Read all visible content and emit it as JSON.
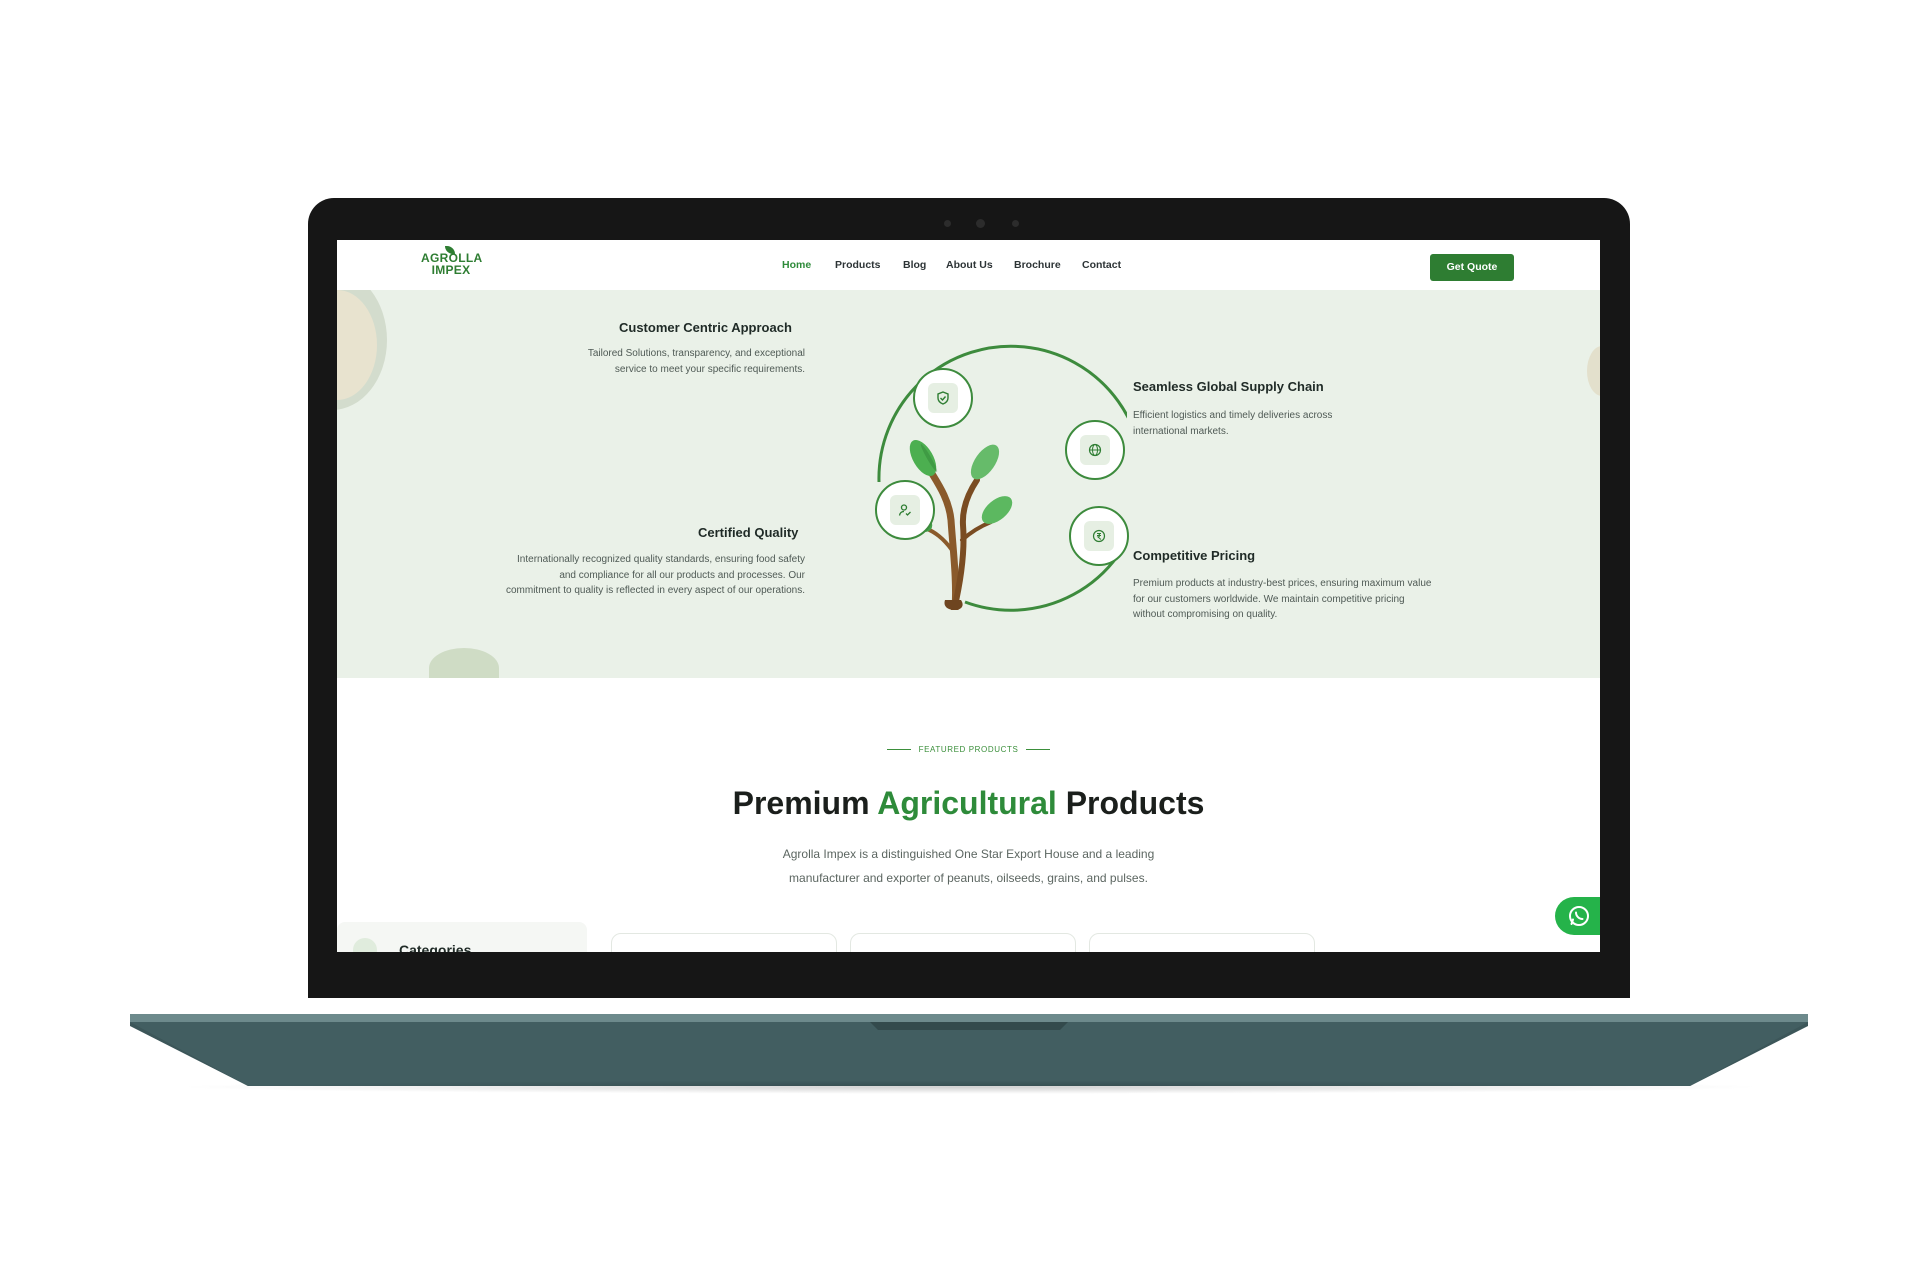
{
  "brand": {
    "name_line1": "AGROLLA",
    "name_line2": "IMPEX",
    "accent_color": "#2e7d32",
    "background_tint": "#eaf1e8"
  },
  "nav": {
    "items": [
      {
        "label": "Home",
        "active": true
      },
      {
        "label": "Products",
        "active": false
      },
      {
        "label": "Blog",
        "active": false
      },
      {
        "label": "About Us",
        "active": false
      },
      {
        "label": "Brochure",
        "active": false
      },
      {
        "label": "Contact",
        "active": false
      }
    ],
    "cta_label": "Get Quote"
  },
  "features": {
    "items": [
      {
        "title": "Customer Centric Approach",
        "desc": "Tailored Solutions, transparency, and exceptional service to meet your specific requirements.",
        "icon": "shield-icon"
      },
      {
        "title": "Certified Quality",
        "desc": "Internationally recognized quality standards, ensuring food safety and compliance for all our products and processes. Our commitment to quality is reflected in every aspect of our operations.",
        "icon": "user-check-icon"
      },
      {
        "title": "Seamless Global Supply Chain",
        "desc": "Efficient logistics and timely deliveries across international markets.",
        "icon": "globe-icon"
      },
      {
        "title": "Competitive Pricing",
        "desc": "Premium products at industry-best prices, ensuring maximum value for our customers worldwide. We maintain competitive pricing without compromising on quality.",
        "icon": "pricing-icon"
      }
    ],
    "center_graphic": "tree-icon"
  },
  "featured": {
    "eyebrow": "FEATURED PRODUCTS",
    "headline_start": "Premium",
    "headline_accent": "Agricultural",
    "headline_end": "Products",
    "subtext_line1": "Agrolla Impex is a distinguished One Star Export House and a leading",
    "subtext_line2": "manufacturer and exporter of peanuts, oilseeds, grains, and pulses."
  },
  "sidebar": {
    "categories_label": "Categories",
    "categories_icon": "grid-icon"
  },
  "floating": {
    "whatsapp_icon": "whatsapp-icon"
  }
}
